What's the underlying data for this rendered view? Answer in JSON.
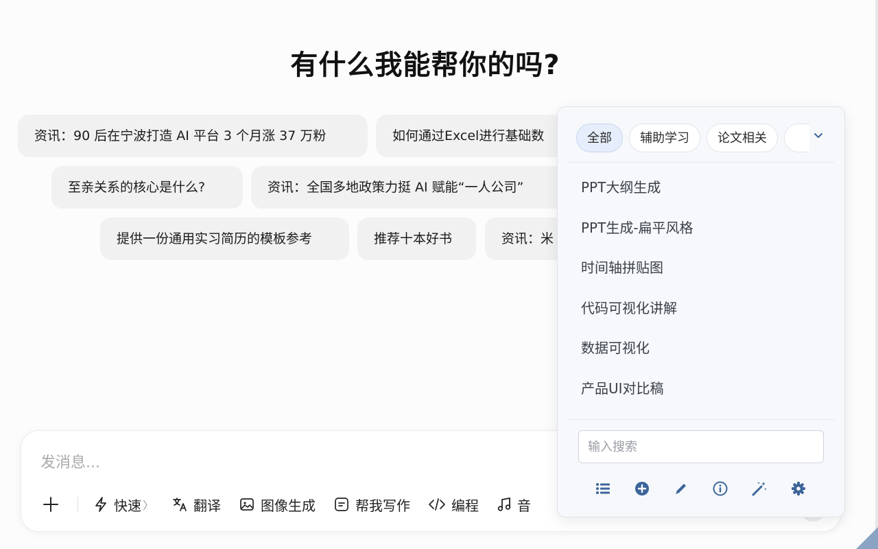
{
  "heading": "有什么我能帮你的吗?",
  "suggestions": [
    "资讯：90 后在宁波打造 AI 平台 3 个月涨 37 万粉",
    "如何通过Excel进行基础数",
    "至亲关系的核心是什么?",
    "资讯：全国多地政策力挺 AI 赋能“一人公司”",
    "提供一份通用实习简历的模板参考",
    "推荐十本好书",
    "资讯：米"
  ],
  "composer": {
    "placeholder": "发消息...",
    "tools": {
      "quick": "快速",
      "translate": "翻译",
      "image_gen": "图像生成",
      "writing": "帮我写作",
      "coding": "编程",
      "music": "音"
    }
  },
  "prompt_panel": {
    "tabs": [
      "全部",
      "辅助学习",
      "论文相关"
    ],
    "active_tab": "全部",
    "items": [
      "PPT大纲生成",
      "PPT生成-扁平风格",
      "时间轴拼贴图",
      "代码可视化讲解",
      "数据可视化",
      "产品UI对比稿"
    ],
    "search_placeholder": "输入搜索"
  },
  "colors": {
    "panel_icon": "#3d6599",
    "active_tab_bg": "#e6eefb",
    "chip_bg": "#f1f1f2"
  },
  "icons": [
    "plus-icon",
    "lightning-icon",
    "translate-icon",
    "image-icon",
    "write-icon",
    "code-icon",
    "music-icon",
    "chevron-down-icon",
    "list-icon",
    "add-circle-icon",
    "pencil-icon",
    "info-icon",
    "magic-wand-icon",
    "gear-icon"
  ]
}
